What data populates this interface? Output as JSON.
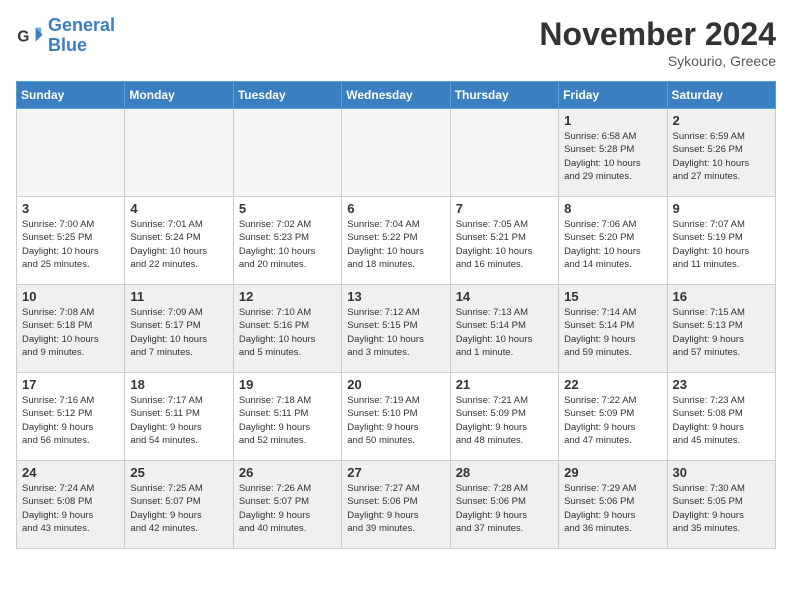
{
  "logo": {
    "line1": "General",
    "line2": "Blue"
  },
  "title": "November 2024",
  "subtitle": "Sykourio, Greece",
  "weekdays": [
    "Sunday",
    "Monday",
    "Tuesday",
    "Wednesday",
    "Thursday",
    "Friday",
    "Saturday"
  ],
  "weeks": [
    [
      {
        "day": "",
        "empty": true
      },
      {
        "day": "",
        "empty": true
      },
      {
        "day": "",
        "empty": true
      },
      {
        "day": "",
        "empty": true
      },
      {
        "day": "",
        "empty": true
      },
      {
        "day": "1",
        "info": "Sunrise: 6:58 AM\nSunset: 5:28 PM\nDaylight: 10 hours\nand 29 minutes."
      },
      {
        "day": "2",
        "info": "Sunrise: 6:59 AM\nSunset: 5:26 PM\nDaylight: 10 hours\nand 27 minutes."
      }
    ],
    [
      {
        "day": "3",
        "info": "Sunrise: 7:00 AM\nSunset: 5:25 PM\nDaylight: 10 hours\nand 25 minutes."
      },
      {
        "day": "4",
        "info": "Sunrise: 7:01 AM\nSunset: 5:24 PM\nDaylight: 10 hours\nand 22 minutes."
      },
      {
        "day": "5",
        "info": "Sunrise: 7:02 AM\nSunset: 5:23 PM\nDaylight: 10 hours\nand 20 minutes."
      },
      {
        "day": "6",
        "info": "Sunrise: 7:04 AM\nSunset: 5:22 PM\nDaylight: 10 hours\nand 18 minutes."
      },
      {
        "day": "7",
        "info": "Sunrise: 7:05 AM\nSunset: 5:21 PM\nDaylight: 10 hours\nand 16 minutes."
      },
      {
        "day": "8",
        "info": "Sunrise: 7:06 AM\nSunset: 5:20 PM\nDaylight: 10 hours\nand 14 minutes."
      },
      {
        "day": "9",
        "info": "Sunrise: 7:07 AM\nSunset: 5:19 PM\nDaylight: 10 hours\nand 11 minutes."
      }
    ],
    [
      {
        "day": "10",
        "info": "Sunrise: 7:08 AM\nSunset: 5:18 PM\nDaylight: 10 hours\nand 9 minutes."
      },
      {
        "day": "11",
        "info": "Sunrise: 7:09 AM\nSunset: 5:17 PM\nDaylight: 10 hours\nand 7 minutes."
      },
      {
        "day": "12",
        "info": "Sunrise: 7:10 AM\nSunset: 5:16 PM\nDaylight: 10 hours\nand 5 minutes."
      },
      {
        "day": "13",
        "info": "Sunrise: 7:12 AM\nSunset: 5:15 PM\nDaylight: 10 hours\nand 3 minutes."
      },
      {
        "day": "14",
        "info": "Sunrise: 7:13 AM\nSunset: 5:14 PM\nDaylight: 10 hours\nand 1 minute."
      },
      {
        "day": "15",
        "info": "Sunrise: 7:14 AM\nSunset: 5:14 PM\nDaylight: 9 hours\nand 59 minutes."
      },
      {
        "day": "16",
        "info": "Sunrise: 7:15 AM\nSunset: 5:13 PM\nDaylight: 9 hours\nand 57 minutes."
      }
    ],
    [
      {
        "day": "17",
        "info": "Sunrise: 7:16 AM\nSunset: 5:12 PM\nDaylight: 9 hours\nand 56 minutes."
      },
      {
        "day": "18",
        "info": "Sunrise: 7:17 AM\nSunset: 5:11 PM\nDaylight: 9 hours\nand 54 minutes."
      },
      {
        "day": "19",
        "info": "Sunrise: 7:18 AM\nSunset: 5:11 PM\nDaylight: 9 hours\nand 52 minutes."
      },
      {
        "day": "20",
        "info": "Sunrise: 7:19 AM\nSunset: 5:10 PM\nDaylight: 9 hours\nand 50 minutes."
      },
      {
        "day": "21",
        "info": "Sunrise: 7:21 AM\nSunset: 5:09 PM\nDaylight: 9 hours\nand 48 minutes."
      },
      {
        "day": "22",
        "info": "Sunrise: 7:22 AM\nSunset: 5:09 PM\nDaylight: 9 hours\nand 47 minutes."
      },
      {
        "day": "23",
        "info": "Sunrise: 7:23 AM\nSunset: 5:08 PM\nDaylight: 9 hours\nand 45 minutes."
      }
    ],
    [
      {
        "day": "24",
        "info": "Sunrise: 7:24 AM\nSunset: 5:08 PM\nDaylight: 9 hours\nand 43 minutes."
      },
      {
        "day": "25",
        "info": "Sunrise: 7:25 AM\nSunset: 5:07 PM\nDaylight: 9 hours\nand 42 minutes."
      },
      {
        "day": "26",
        "info": "Sunrise: 7:26 AM\nSunset: 5:07 PM\nDaylight: 9 hours\nand 40 minutes."
      },
      {
        "day": "27",
        "info": "Sunrise: 7:27 AM\nSunset: 5:06 PM\nDaylight: 9 hours\nand 39 minutes."
      },
      {
        "day": "28",
        "info": "Sunrise: 7:28 AM\nSunset: 5:06 PM\nDaylight: 9 hours\nand 37 minutes."
      },
      {
        "day": "29",
        "info": "Sunrise: 7:29 AM\nSunset: 5:06 PM\nDaylight: 9 hours\nand 36 minutes."
      },
      {
        "day": "30",
        "info": "Sunrise: 7:30 AM\nSunset: 5:05 PM\nDaylight: 9 hours\nand 35 minutes."
      }
    ]
  ]
}
